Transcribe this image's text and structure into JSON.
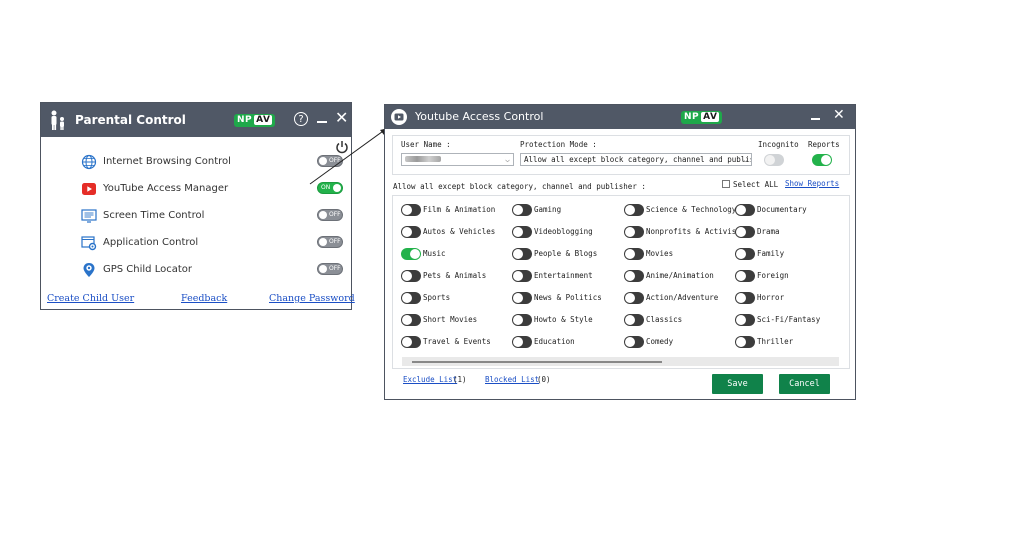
{
  "parental": {
    "title": "Parental Control",
    "badge_np": "NP",
    "badge_av": "AV",
    "items": [
      {
        "label": "Internet Browsing Control",
        "state": "OFF",
        "icon": "globe-icon"
      },
      {
        "label": "YouTube Access Manager",
        "state": "ON",
        "icon": "youtube-icon"
      },
      {
        "label": "Screen Time Control",
        "state": "OFF",
        "icon": "screen-icon"
      },
      {
        "label": "Application Control",
        "state": "OFF",
        "icon": "app-gear-icon"
      },
      {
        "label": "GPS Child Locator",
        "state": "OFF",
        "icon": "location-pin-icon"
      }
    ],
    "links": {
      "create_child": "Create Child User",
      "feedback": "Feedback",
      "change_password": "Change Password"
    }
  },
  "youtube": {
    "title": "Youtube Access Control",
    "badge_np": "NP",
    "badge_av": "AV",
    "user_name_label": "User Name :",
    "protection_label": "Protection Mode :",
    "protection_value": "Allow all except block category, channel and publisher",
    "incognito_label": "Incognito",
    "reports_label": "Reports",
    "mode_caption": "Allow all except block category, channel and publisher :",
    "select_all_label": "Select ALL",
    "show_reports": "Show Reports",
    "categories": [
      [
        "Film & Animation",
        "Gaming",
        "Science & Technology",
        "Documentary"
      ],
      [
        "Autos & Vehicles",
        "Videoblogging",
        "Nonprofits & Activism",
        "Drama"
      ],
      [
        "Music",
        "People & Blogs",
        "Movies",
        "Family"
      ],
      [
        "Pets & Animals",
        "Entertainment",
        "Anime/Animation",
        "Foreign"
      ],
      [
        "Sports",
        "News & Politics",
        "Action/Adventure",
        "Horror"
      ],
      [
        "Short Movies",
        "Howto & Style",
        "Classics",
        "Sci-Fi/Fantasy"
      ],
      [
        "Travel & Events",
        "Education",
        "Comedy",
        "Thriller"
      ]
    ],
    "on_categories": [
      "Music"
    ],
    "exclude_list_label": "Exclude List",
    "exclude_count": "(1)",
    "blocked_list_label": "Blocked List",
    "blocked_count": "(0)",
    "save_label": "Save",
    "cancel_label": "Cancel"
  },
  "colors": {
    "titlebar": "#505866",
    "toggle_on": "#23b24b",
    "toggle_off": "#3c3c3c",
    "button": "#10824a",
    "link": "#1a4ec5"
  }
}
